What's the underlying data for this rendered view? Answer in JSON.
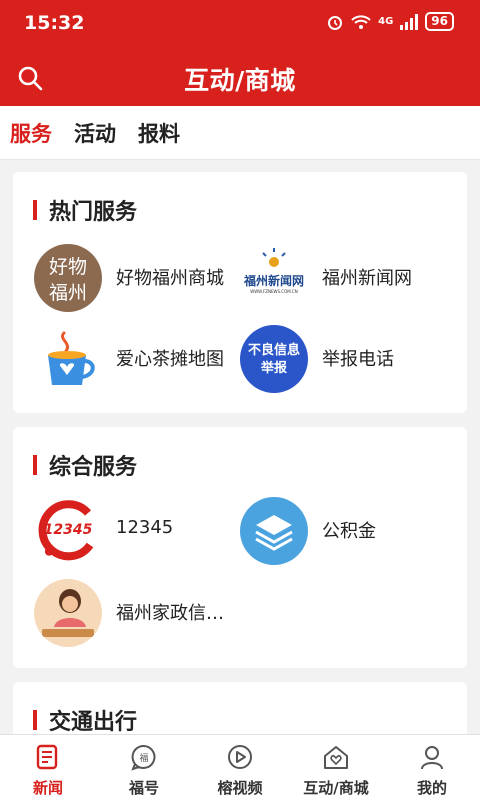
{
  "status_bar": {
    "time": "15:32",
    "signal_label": "4G",
    "battery": "96"
  },
  "header": {
    "title": "互动/商城"
  },
  "tabs": [
    {
      "label": "服务",
      "active": true
    },
    {
      "label": "活动",
      "active": false
    },
    {
      "label": "报料",
      "active": false
    }
  ],
  "sections": [
    {
      "title": "热门服务",
      "items": [
        {
          "label": "好物福州商城",
          "icon": "haowu-fuzhou-logo",
          "icon_text_top": "好物",
          "icon_text_bottom": "福州"
        },
        {
          "label": "福州新闻网",
          "icon": "fznews-logo",
          "icon_text": "福州新闻网",
          "icon_subtext": "WWW.FZNEWS.COM.CN"
        },
        {
          "label": "爱心茶摊地图",
          "icon": "tea-cup-icon"
        },
        {
          "label": "举报电话",
          "icon": "report-badge-icon",
          "icon_text_top": "不良信息",
          "icon_text_bottom": "举报"
        }
      ]
    },
    {
      "title": "综合服务",
      "items": [
        {
          "label": "12345",
          "icon": "hotline-12345-logo",
          "icon_text": "12345"
        },
        {
          "label": "公积金",
          "icon": "layers-icon"
        },
        {
          "label": "福州家政信…",
          "icon": "housekeeping-avatar"
        }
      ]
    },
    {
      "title": "交通出行",
      "items": []
    }
  ],
  "bottom_nav": [
    {
      "label": "新闻",
      "icon": "news-icon",
      "active": true
    },
    {
      "label": "福号",
      "icon": "fuhao-icon",
      "active": false
    },
    {
      "label": "榕视频",
      "icon": "video-play-icon",
      "active": false
    },
    {
      "label": "互动/商城",
      "icon": "home-heart-icon",
      "active": false
    },
    {
      "label": "我的",
      "icon": "user-icon",
      "active": false
    }
  ],
  "colors": {
    "brand_red": "#d8211d",
    "background": "#f2f2f2",
    "card": "#ffffff",
    "icon_blue": "#4aa3df",
    "icon_brown": "#8c6a50"
  }
}
